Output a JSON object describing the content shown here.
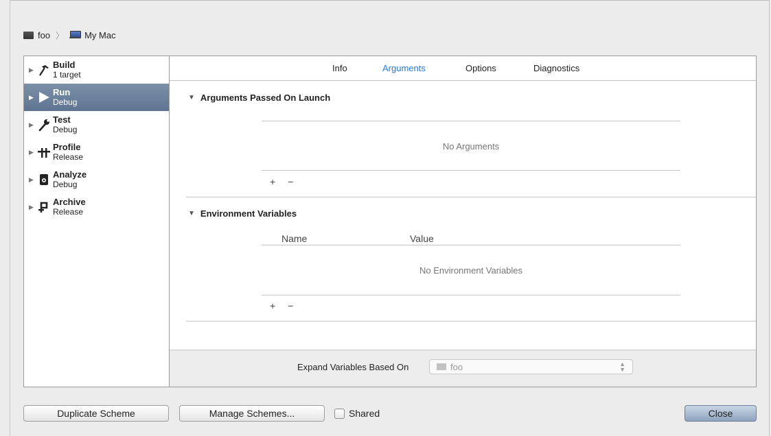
{
  "breadcrumb": {
    "scheme": "foo",
    "destination": "My Mac"
  },
  "sidebar": {
    "items": [
      {
        "title": "Build",
        "subtitle": "1 target",
        "icon": "hammer-icon",
        "selected": false
      },
      {
        "title": "Run",
        "subtitle": "Debug",
        "icon": "play-icon",
        "selected": true
      },
      {
        "title": "Test",
        "subtitle": "Debug",
        "icon": "wrench-icon",
        "selected": false
      },
      {
        "title": "Profile",
        "subtitle": "Release",
        "icon": "caliper-icon",
        "selected": false
      },
      {
        "title": "Analyze",
        "subtitle": "Debug",
        "icon": "analyze-icon",
        "selected": false
      },
      {
        "title": "Archive",
        "subtitle": "Release",
        "icon": "archive-icon",
        "selected": false
      }
    ]
  },
  "tabs": [
    {
      "label": "Info",
      "active": false
    },
    {
      "label": "Arguments",
      "active": true
    },
    {
      "label": "Options",
      "active": false
    },
    {
      "label": "Diagnostics",
      "active": false
    }
  ],
  "arguments": {
    "title": "Arguments Passed On Launch",
    "empty": "No Arguments",
    "add": "+",
    "remove": "−"
  },
  "environment": {
    "title": "Environment Variables",
    "col_name": "Name",
    "col_value": "Value",
    "empty": "No Environment Variables",
    "add": "+",
    "remove": "−"
  },
  "expand": {
    "label": "Expand Variables Based On",
    "value": "foo"
  },
  "footer": {
    "duplicate": "Duplicate Scheme",
    "manage": "Manage Schemes...",
    "shared": "Shared",
    "close": "Close"
  },
  "colors": {
    "accent": "#2a7ad6",
    "selection": "#6a7f9b"
  }
}
